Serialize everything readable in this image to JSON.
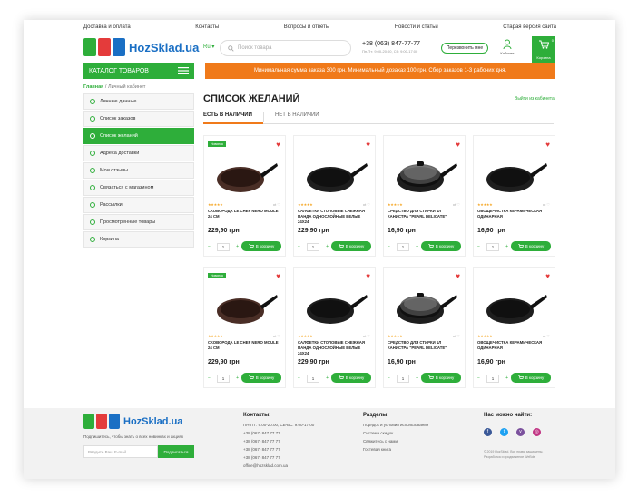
{
  "topnav": [
    "Доставка и оплата",
    "Контакты",
    "Вопросы и ответы",
    "Новости и статьи",
    "Старая версия сайта"
  ],
  "header": {
    "logo_text": "HozSklad.ua",
    "lang": "Ru ▾",
    "search_placeholder": "Поиск товара",
    "phone": "+38 (063) 847-77-77",
    "phone_hours": "Пн-Пт: 9:00-20:00, Сб: 9:00-17:00",
    "callback": "Перезвонить мне",
    "cabinet": "Кабинет",
    "cart_label": "Корзина",
    "cart_count": "0"
  },
  "catalog_label": "КАТАЛОГ ТОВАРОВ",
  "banner": "Минимальная сумма заказа 300 грн. Минимальный дозаказ 100 грн. Сбор заказов 1-3 рабочих дня.",
  "breadcrumbs": {
    "home": "Главная",
    "current": " / Личный кабинет"
  },
  "sidemenu": [
    {
      "label": "Личные данные",
      "active": false
    },
    {
      "label": "Список заказов",
      "active": false
    },
    {
      "label": "Список желаний",
      "active": true
    },
    {
      "label": "Адреса доставки",
      "active": false
    },
    {
      "label": "Мои отзывы",
      "active": false
    },
    {
      "label": "Связаться с магазином",
      "active": false
    },
    {
      "label": "Рассылки",
      "active": false
    },
    {
      "label": "Просмотренные товары",
      "active": false
    },
    {
      "label": "Корзина",
      "active": false
    }
  ],
  "page_title": "СПИСОК ЖЕЛАНИЙ",
  "logout": "Выйти из кабинета",
  "tabs": [
    "ЕСТЬ В НАЛИЧИИ",
    "НЕТ В НАЛИЧИИ"
  ],
  "products": [
    {
      "name": "СКОВОРОДА LE CHEF NERO MOULE 24 СМ",
      "price": "229,90 грн",
      "badge": "Новинка",
      "kind": "brown"
    },
    {
      "name": "САЛФЕТКИ СТОЛОВЫЕ СНЕЖНАЯ ПАНДА ОДНОСЛОЙНЫЕ БЕЛЫЕ 24Х24",
      "price": "229,90 грн",
      "badge": "",
      "kind": "dark"
    },
    {
      "name": "СРЕДСТВО ДЛЯ СТИРКИ 1Л КАНИСТРА \"PEARL DELICATE\"",
      "price": "16,90 грн",
      "badge": "",
      "kind": "lid"
    },
    {
      "name": "ОВОЩЕЧИСТКА КЕРАМИЧЕСКАЯ ОДИНАРНАЯ",
      "price": "16,90 грн",
      "badge": "",
      "kind": "dark"
    },
    {
      "name": "СКОВОРОДА LE CHEF NERO MOULE 24 СМ",
      "price": "229,90 грн",
      "badge": "Новинка",
      "kind": "brown"
    },
    {
      "name": "САЛФЕТКИ СТОЛОВЫЕ СНЕЖНАЯ ПАНДА ОДНОСЛОЙНЫЕ БЕЛЫЕ 24Х24",
      "price": "229,90 грн",
      "badge": "",
      "kind": "dark"
    },
    {
      "name": "СРЕДСТВО ДЛЯ СТИРКИ 1Л КАНИСТРА \"PEARL DELICATE\"",
      "price": "16,90 грн",
      "badge": "",
      "kind": "lid"
    },
    {
      "name": "ОВОЩЕЧИСТКА КЕРАМИЧЕСКАЯ ОДИНАРНАЯ",
      "price": "16,90 грн",
      "badge": "",
      "kind": "dark"
    }
  ],
  "qty_default": "1",
  "to_cart": "В корзину",
  "footer": {
    "logo_text": "HozSklad.ua",
    "subscribe_text": "Подпишитесь, чтобы знать о всех новинках и акциях",
    "email_placeholder": "Введите Ваш E-mail",
    "subscribe_btn": "Подписаться",
    "contacts_title": "Контакты:",
    "contacts": [
      "ПН-ПТ: 9:00-20:00, СБ-ВС: 9:00-17:00",
      "+38 (067) 847 77 77",
      "+38 (067) 847 77 77",
      "+38 (067) 847 77 77",
      "+38 (067) 847 77 77",
      "office@hozsklad.com.ua"
    ],
    "sections_title": "Разделы:",
    "sections": [
      "Порядок и условия использования",
      "Система скидок",
      "Свяжитесь с нами",
      "Гостевая книга"
    ],
    "social_title": "Нас можно найти:",
    "copyright": "© 2019 HozSklad. Все права защищены.",
    "developer": "Разработка и продвижение WeBde"
  },
  "colors": {
    "green": "#2eae3a",
    "orange": "#f07a1a",
    "blue": "#1a6fc4",
    "heart": "#e43b3b"
  }
}
